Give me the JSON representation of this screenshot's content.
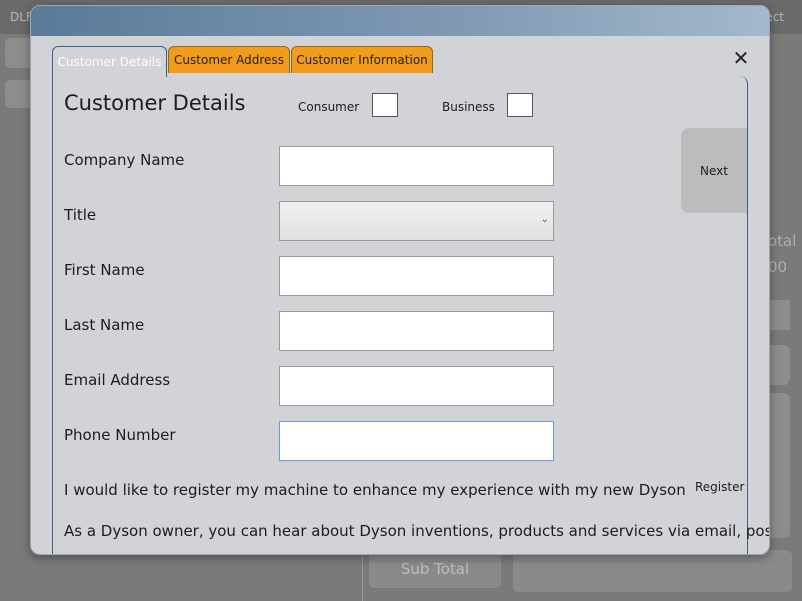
{
  "background": {
    "topbar_left": "DLF",
    "topbar_right": "ect",
    "right_text_1": "otal",
    "right_text_2": "00",
    "subtotal_label": "Sub Total"
  },
  "modal": {
    "close_symbol": "✕",
    "tabs": [
      {
        "label": "Customer Details",
        "active": true
      },
      {
        "label": "Customer Address",
        "active": false
      },
      {
        "label": "Customer Information",
        "active": false
      }
    ],
    "heading": "Customer Details",
    "consumer_label": "Consumer",
    "business_label": "Business",
    "next_label": "Next",
    "fields": [
      {
        "label": "Company Name",
        "value": ""
      },
      {
        "label": "Title",
        "value": ""
      },
      {
        "label": "First Name",
        "value": ""
      },
      {
        "label": "Last Name",
        "value": ""
      },
      {
        "label": "Email Address",
        "value": ""
      },
      {
        "label": "Phone Number",
        "value": ""
      }
    ],
    "register_text": "I would like to register my machine to enhance my experience with my new Dyson",
    "register_label": "Register",
    "marketing_text": "As a Dyson owner, you can hear about Dyson inventions, products and services via email, post, te"
  },
  "colors": {
    "tab_inactive": "#f39c1c",
    "tab_active_border": "#3b5f8a",
    "modal_bg": "#d1d3d6"
  }
}
